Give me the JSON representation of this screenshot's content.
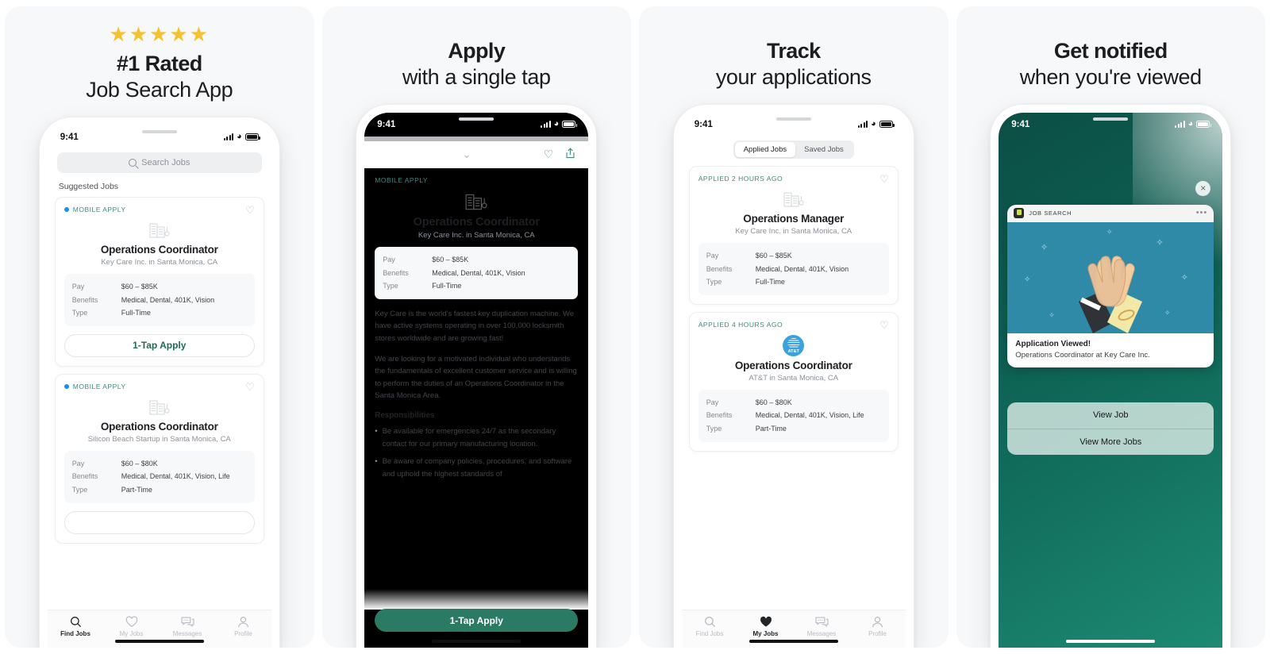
{
  "panels": [
    {
      "stars": "★★★★★",
      "headline_bold": "#1 Rated",
      "headline_light": "Job Search App",
      "status": {
        "time": "9:41"
      },
      "search_placeholder": "Search Jobs",
      "section_label": "Suggested Jobs",
      "cards": [
        {
          "tag": "MOBILE APPLY",
          "title": "Operations Coordinator",
          "company": "Key Care Inc. in Santa Monica, CA",
          "meta": [
            {
              "k": "Pay",
              "v": "$60 – $85K"
            },
            {
              "k": "Benefits",
              "v": "Medical, Dental, 401K, Vision"
            },
            {
              "k": "Type",
              "v": "Full-Time"
            }
          ],
          "cta": "1-Tap Apply"
        },
        {
          "tag": "MOBILE APPLY",
          "title": "Operations Coordinator",
          "company": "Silicon Beach Startup in Santa Monica, CA",
          "meta": [
            {
              "k": "Pay",
              "v": "$60 – $80K"
            },
            {
              "k": "Benefits",
              "v": "Medical, Dental, 401K, Vision, Life"
            },
            {
              "k": "Type",
              "v": "Part-Time"
            }
          ],
          "cta": ""
        }
      ],
      "tabs": [
        {
          "label": "Find Jobs",
          "icon": "search-icon",
          "active": true
        },
        {
          "label": "My Jobs",
          "icon": "heart-icon",
          "active": false
        },
        {
          "label": "Messages",
          "icon": "messages-icon",
          "active": false
        },
        {
          "label": "Profile",
          "icon": "profile-icon",
          "active": false
        }
      ]
    },
    {
      "headline_bold": "Apply",
      "headline_light": "with a single tap",
      "status": {
        "time": "9:41"
      },
      "tag": "MOBILE APPLY",
      "title": "Operations Coordinator",
      "company": "Key Care Inc. in Santa Monica, CA",
      "meta": [
        {
          "k": "Pay",
          "v": "$60 – $85K"
        },
        {
          "k": "Benefits",
          "v": "Medical, Dental, 401K, Vision"
        },
        {
          "k": "Type",
          "v": "Full-Time"
        }
      ],
      "paragraphs": [
        "Key Care is the world's fastest key duplication machine. We have active systems operating in over 100,000 locksmith stores worldwide and are growing fast!",
        "We are looking for a motivated individual who understands the fundamentals of excellent customer service and is willing to perform the duties of an Operations Coordinator in the Santa Monica Area."
      ],
      "responsibilities_heading": "Responsibilities",
      "responsibilities": [
        "Be available for emergencies 24/7 as the secondary contact for our primary manufacturing location.",
        "Be aware of company policies, procedures, and software and uphold the highest standards of"
      ],
      "cta": "1-Tap Apply"
    },
    {
      "headline_bold": "Track",
      "headline_light": "your applications",
      "status": {
        "time": "9:41"
      },
      "segments": [
        {
          "label": "Applied Jobs",
          "active": true
        },
        {
          "label": "Saved Jobs",
          "active": false
        }
      ],
      "cards": [
        {
          "tag": "APPLIED 2 HOURS AGO",
          "title": "Operations Manager",
          "company": "Key Care Inc. in Santa Monica, CA",
          "logo": "building-icon",
          "meta": [
            {
              "k": "Pay",
              "v": "$60 – $85K"
            },
            {
              "k": "Benefits",
              "v": "Medical, Dental, 401K, Vision"
            },
            {
              "k": "Type",
              "v": "Full-Time"
            }
          ]
        },
        {
          "tag": "APPLIED 4 HOURS AGO",
          "title": "Operations Coordinator",
          "company": "AT&T in Santa Monica, CA",
          "logo": "att-logo",
          "logo_text": "AT&T",
          "meta": [
            {
              "k": "Pay",
              "v": "$60 – $80K"
            },
            {
              "k": "Benefits",
              "v": "Medical, Dental, 401K, Vision, Life"
            },
            {
              "k": "Type",
              "v": "Part-Time"
            }
          ]
        }
      ],
      "tabs": [
        {
          "label": "Find Jobs",
          "icon": "search-icon",
          "active": false
        },
        {
          "label": "My Jobs",
          "icon": "heart-icon",
          "active": true
        },
        {
          "label": "Messages",
          "icon": "messages-icon",
          "active": false
        },
        {
          "label": "Profile",
          "icon": "profile-icon",
          "active": false
        }
      ]
    },
    {
      "headline_bold": "Get notified",
      "headline_light": "when you're viewed",
      "status": {
        "time": "9:41"
      },
      "close_label": "×",
      "notification": {
        "app_name": "JOB SEARCH",
        "more_label": "•••",
        "title": "Application Viewed!",
        "body": "Operations Coordinator at Key Care Inc."
      },
      "actions": [
        {
          "label": "View Job"
        },
        {
          "label": "View More Jobs"
        }
      ]
    }
  ],
  "colors": {
    "star": "#F5C12E",
    "brand_green": "#2b7a63",
    "teal_text": "#3f8a7d",
    "blue_dot": "#1b8ef2",
    "att_blue": "#3aa2dd",
    "panel_bg": "#f7f8f9",
    "notif_img_bg": "#2f8aa8"
  }
}
